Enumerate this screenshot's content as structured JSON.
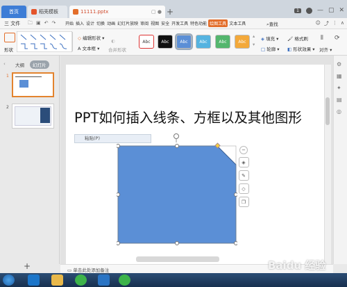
{
  "tabs": {
    "home": "首页",
    "template": "稻壳模板",
    "file": "11111.pptx",
    "new_tab": "+"
  },
  "window": {
    "badge": "1"
  },
  "menu": {
    "file": "三 文件",
    "tabs": [
      "开始",
      "插入",
      "设计",
      "切换",
      "动画",
      "幻灯片放映",
      "审阅",
      "视图",
      "安全",
      "开发工具",
      "特色功能",
      "绘图工具",
      "文本工具"
    ],
    "active_tab": "绘图工具",
    "search": "查找"
  },
  "ribbon": {
    "shape_label": "形状",
    "edit_shape": "编辑形状",
    "textbox": "文本框",
    "merge_shape": "合并形状",
    "style_buttons": [
      "Abc",
      "Abc",
      "Abc",
      "Abc",
      "Abc",
      "Abc"
    ],
    "style_colors": [
      "#ffffff",
      "#111111",
      "#5b8fd6",
      "#55b3e0",
      "#54b66e",
      "#f3a93b"
    ],
    "fill": "填充",
    "outline": "轮廓",
    "format_brush": "格式刷",
    "shape_effect": "形状效果",
    "align": "对齐"
  },
  "left_pane": {
    "outline_tab": "大纲",
    "slides_tab": "幻灯片",
    "slide_numbers": [
      "1",
      "2"
    ]
  },
  "slide": {
    "title": "PPT如何插入线条、方框以及其他图形",
    "paste_label": "粘贴(P)",
    "shape_color": "#5b8fd6"
  },
  "notes": {
    "placeholder": "单击此处添加备注"
  },
  "bottom": {
    "add_slide": "+"
  },
  "watermark": "Baidu 经验"
}
